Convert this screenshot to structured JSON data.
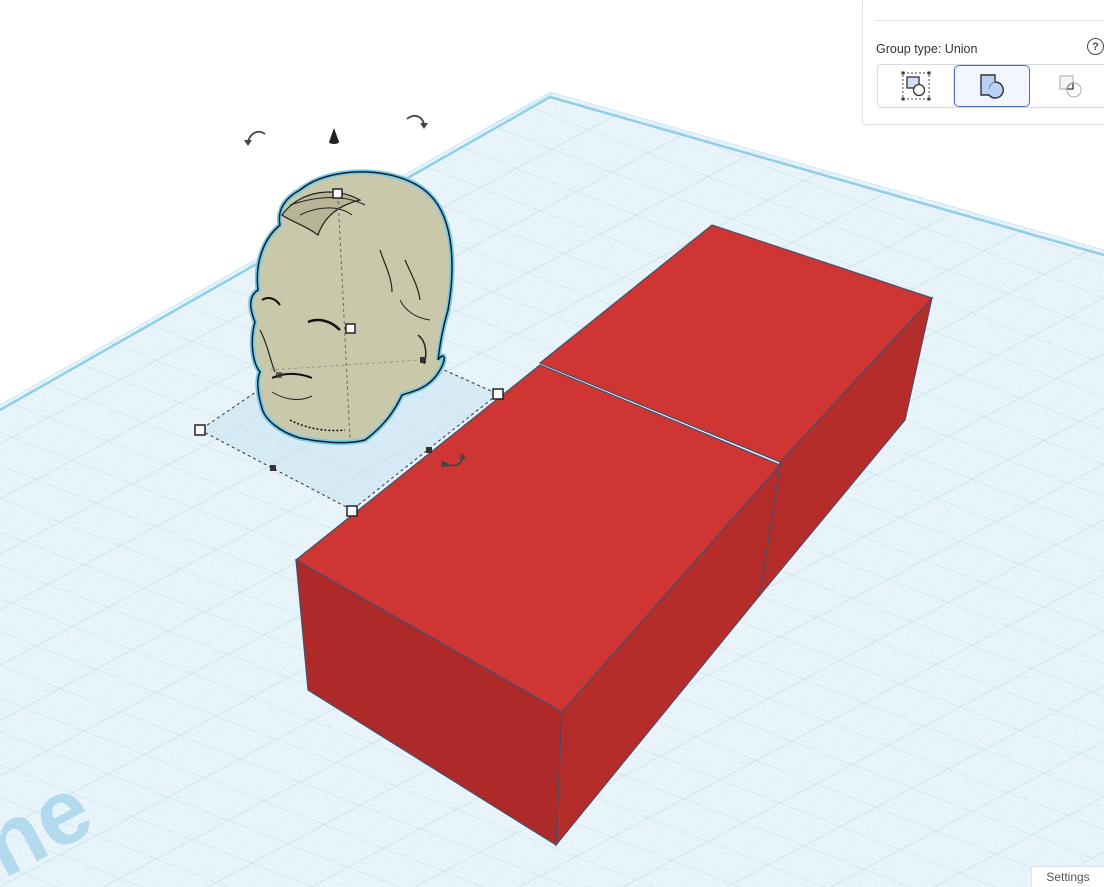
{
  "workplane": {
    "watermark": "ne",
    "grid_color": "#c8dfec",
    "plate_color": "#eaf5fb",
    "edge_color": "#7cc6e2"
  },
  "boxes": {
    "color_top": "#cf3633",
    "color_left": "#ad2a28",
    "color_right": "#b52d2b",
    "outline": "#4a4e6a"
  },
  "head": {
    "color": "#c9c8aa",
    "highlight": "#73c9ea"
  },
  "gizmo": {
    "rotate_left_icon": "rotate-ccw-icon",
    "rotate_right_icon": "rotate-cw-icon",
    "rotate_z_icon": "rotate-z-icon",
    "lift_icon": "cone-lift-icon"
  },
  "inspector": {
    "group_type_label": "Group type: Union",
    "help_symbol": "?",
    "options": [
      {
        "name": "combine",
        "icon": "group-combine-icon",
        "selected": false
      },
      {
        "name": "union",
        "icon": "group-union-icon",
        "selected": true
      },
      {
        "name": "subtract",
        "icon": "group-subtract-icon",
        "selected": false
      }
    ],
    "accent": "#4a6fb5"
  },
  "settings_label": "Settings"
}
